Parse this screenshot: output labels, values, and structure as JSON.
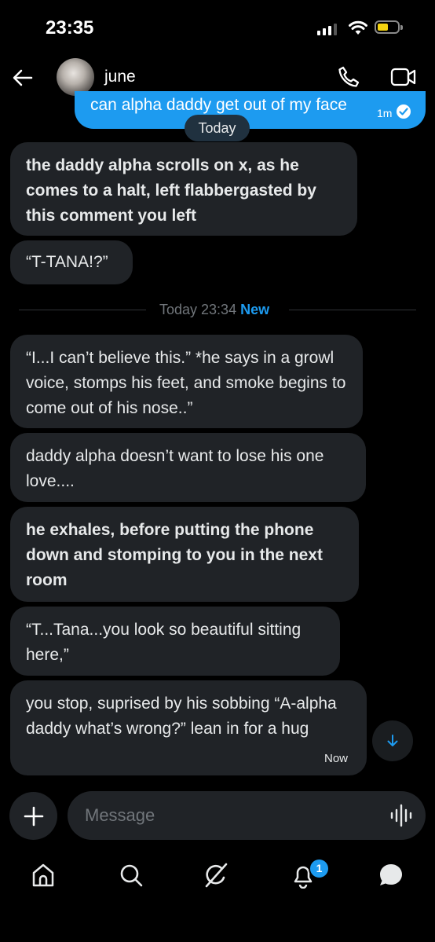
{
  "status_bar": {
    "time": "23:35"
  },
  "header": {
    "contact_name": "june"
  },
  "sent_message": {
    "text": "can alpha daddy get out of my face",
    "time": "1m"
  },
  "date_pill": "Today",
  "messages_before": [
    {
      "text": "the daddy alpha scrolls on x, as he comes to a halt, left flabbergasted by this comment you left"
    },
    {
      "text": "“T-TANA!?”"
    }
  ],
  "divider": {
    "time": "Today 23:34",
    "new_label": "New"
  },
  "messages_after": [
    {
      "text": "“I...I can’t believe this.” *he says in a growl voice, stomps his feet, and smoke begins to come out of his nose..”"
    },
    {
      "text": "daddy alpha doesn’t want to lose his one love...."
    },
    {
      "text": "he exhales, before putting the phone down and stomping to you in the next room"
    },
    {
      "text": "“T...Tana...you look so beautiful sitting here,”"
    },
    {
      "text": "you stop, suprised by his sobbing “A-alpha daddy what’s wrong?” lean in for a hug",
      "time": "Now"
    }
  ],
  "composer": {
    "placeholder": "Message"
  },
  "nav": {
    "notifications_count": "1"
  },
  "colors": {
    "accent": "#1d9bf0",
    "bubble": "#202327",
    "background": "#000000",
    "battery": "#f5d410"
  }
}
